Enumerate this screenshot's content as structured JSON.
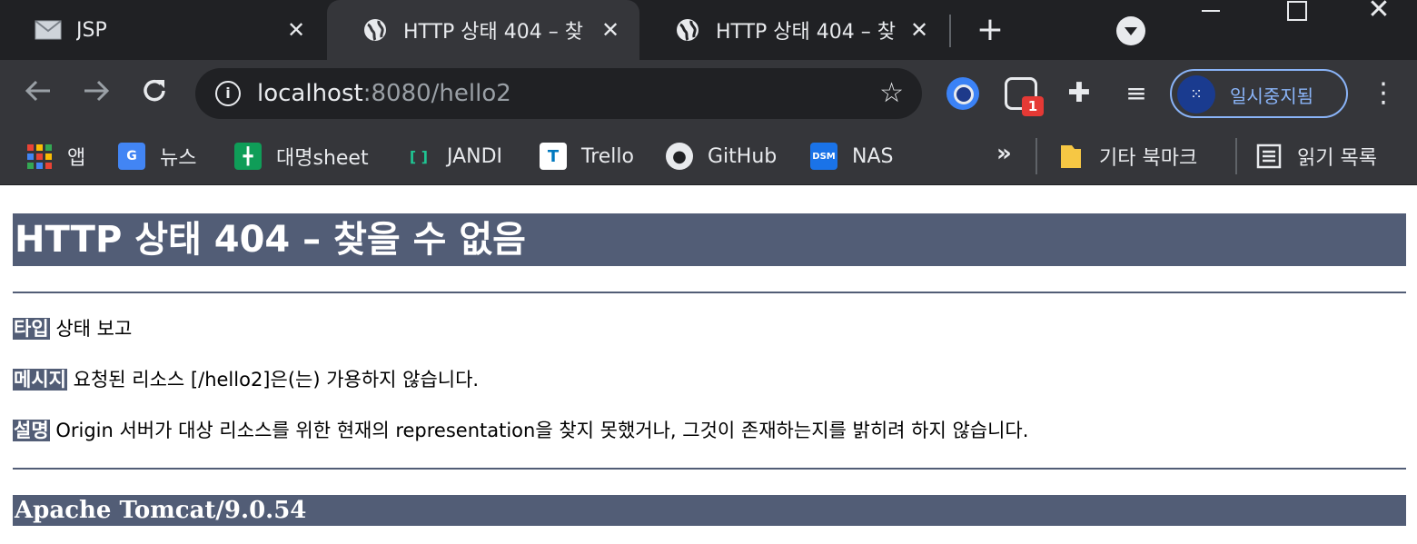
{
  "browser": {
    "tabs": [
      {
        "title": "JSP",
        "icon": "mail-icon",
        "active": false
      },
      {
        "title": "HTTP 상태 404 – 찾",
        "icon": "globe-icon",
        "active": true
      },
      {
        "title": "HTTP 상태 404 – 찾",
        "icon": "globe-icon",
        "active": false
      }
    ],
    "tab_close_glyph": "✕",
    "new_tab_glyph": "+",
    "address": {
      "host": "localhost",
      "rest": ":8080/hello2"
    },
    "profile_label": "일시중지됨",
    "extension_badge": "1"
  },
  "bookmarks": {
    "items": [
      {
        "label": "앱",
        "icon": "apps-grid-icon"
      },
      {
        "label": "뉴스",
        "icon": "google-news-icon",
        "icon_text": "G"
      },
      {
        "label": "대명sheet",
        "icon": "sheets-icon",
        "icon_text": "╋"
      },
      {
        "label": "JANDI",
        "icon": "jandi-icon",
        "icon_text": "[ ]"
      },
      {
        "label": "Trello",
        "icon": "trello-icon",
        "icon_text": "T"
      },
      {
        "label": "GitHub",
        "icon": "github-icon",
        "icon_text": "●"
      },
      {
        "label": "NAS",
        "icon": "dsm-icon",
        "icon_text": "DSM"
      }
    ],
    "more_glyph": "»",
    "other_label": "기타 북마크",
    "reading_list_label": "읽기 목록"
  },
  "page": {
    "title": "HTTP 상태 404 – 찾을 수 없음",
    "type_label": "타입",
    "type_value": "상태 보고",
    "message_label": "메시지",
    "message_value": "요청된 리소스 [/hello2]은(는) 가용하지 않습니다.",
    "description_label": "설명",
    "description_value": "Origin 서버가 대상 리소스를 위한 현재의 representation을 찾지 못했거나, 그것이 존재하는지를 밝히려 하지 않습니다.",
    "server_footer": "Apache Tomcat/9.0.54"
  },
  "colors": {
    "tomcat_header": "#525d76",
    "chrome_dark": "#202124",
    "chrome_toolbar": "#35363a",
    "profile_accent": "#8ab4f8"
  }
}
